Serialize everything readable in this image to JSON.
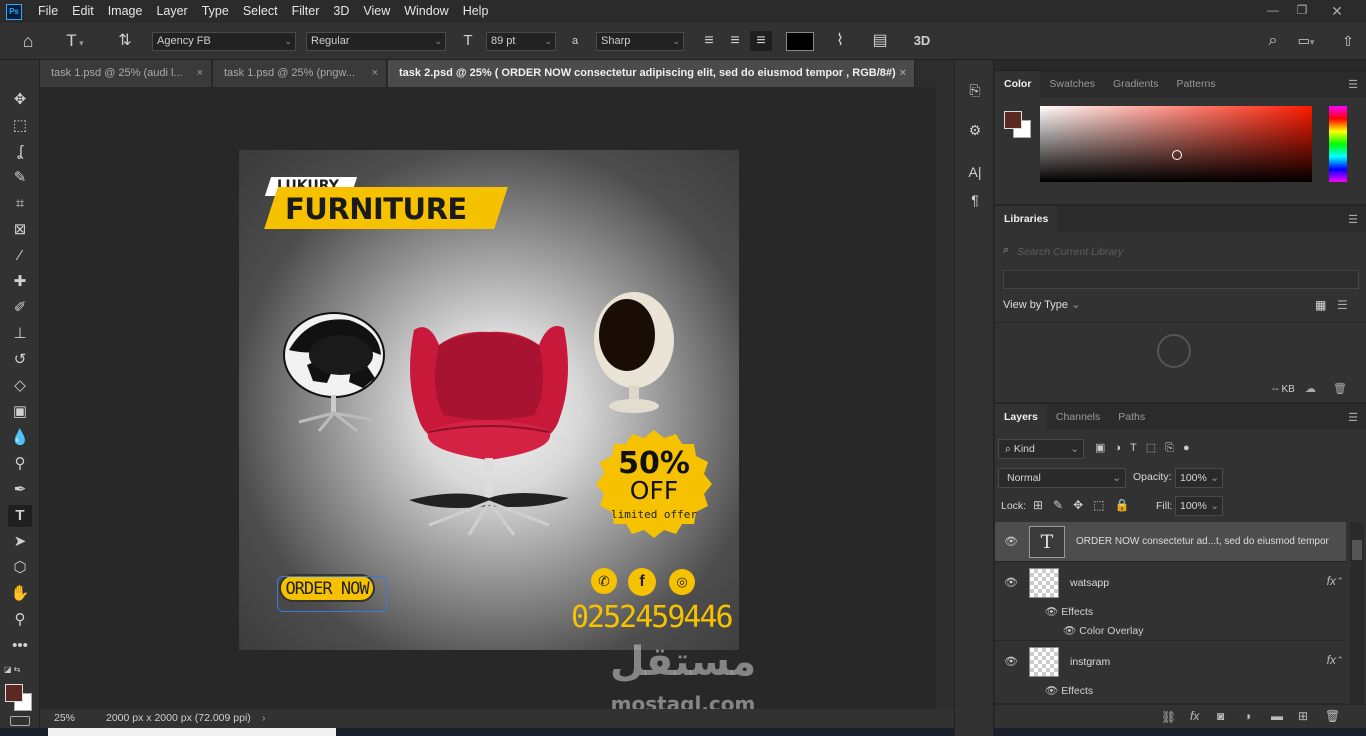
{
  "app": {
    "logo": "Ps"
  },
  "menu": [
    "File",
    "Edit",
    "Image",
    "Layer",
    "Type",
    "Select",
    "Filter",
    "3D",
    "View",
    "Window",
    "Help"
  ],
  "options": {
    "font_family": "Agency FB",
    "font_style": "Regular",
    "font_size": "89 pt",
    "aa_label": "a",
    "antialias": "Sharp",
    "three_d": "3D"
  },
  "tabs": [
    {
      "label": "task 1.psd @ 25% (audi l..."
    },
    {
      "label": "task 1.psd @ 25% (pngw..."
    },
    {
      "label": "task 2.psd @ 25% (  ORDER NOW consectetur adipiscing elit, sed do eiusmod tempor , RGB/8#)"
    }
  ],
  "artwork": {
    "tag": "LUKURY",
    "title": "FURNITURE",
    "badge_percent": "50%",
    "badge_off": "OFF",
    "badge_sub": "limited offer",
    "order_button": "ORDER NOW",
    "phone": "0252459446",
    "social": [
      "whatsapp-icon",
      "facebook-icon",
      "instagram-icon"
    ],
    "colors": {
      "accent": "#f6c200",
      "chair_red": "#c8193a"
    }
  },
  "status": {
    "zoom": "25%",
    "doc_info": "2000 px x 2000 px (72.009 ppi)"
  },
  "color_panel": {
    "tabs": [
      "Color",
      "Swatches",
      "Gradients",
      "Patterns"
    ],
    "foreground": "#5a2a22",
    "background": "#ffffff"
  },
  "libraries": {
    "tab": "Libraries",
    "search_placeholder": "Search Current Library",
    "view_by": "View by Type",
    "size": "-- KB"
  },
  "layers": {
    "tabs": [
      "Layers",
      "Channels",
      "Paths"
    ],
    "filter_kind": "Kind",
    "blend_mode": "Normal",
    "opacity_label": "Opacity:",
    "opacity": "100%",
    "lock_label": "Lock:",
    "fill_label": "Fill:",
    "fill": "100%",
    "rows": [
      {
        "name": "ORDER NOW consectetur ad...t, sed do eiusmod tempor"
      },
      {
        "name": "watsapp"
      },
      {
        "name": "instgram"
      }
    ],
    "effects_label": "Effects",
    "effect_color_overlay": "Color Overlay"
  },
  "watermark": {
    "arabic": "مستقل",
    "latin": "mostaql.com"
  }
}
